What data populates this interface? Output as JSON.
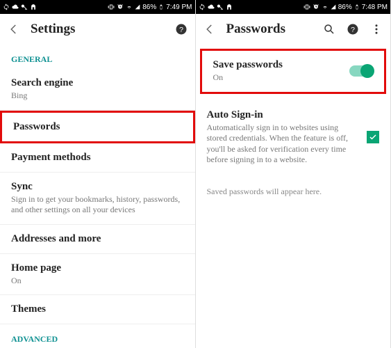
{
  "left": {
    "statusbar": {
      "battery": "86%",
      "time": "7:49 PM"
    },
    "title": "Settings",
    "section_general": "GENERAL",
    "items": {
      "search_engine": {
        "label": "Search engine",
        "value": "Bing"
      },
      "passwords": {
        "label": "Passwords"
      },
      "payment_methods": {
        "label": "Payment methods"
      },
      "sync": {
        "label": "Sync",
        "desc": "Sign in to get your bookmarks, history, passwords, and other settings on all your devices"
      },
      "addresses": {
        "label": "Addresses and more"
      },
      "home_page": {
        "label": "Home page",
        "value": "On"
      },
      "themes": {
        "label": "Themes"
      }
    },
    "section_advanced": "ADVANCED"
  },
  "right": {
    "statusbar": {
      "battery": "86%",
      "time": "7:48 PM"
    },
    "title": "Passwords",
    "save_passwords": {
      "label": "Save passwords",
      "value": "On"
    },
    "auto_signin": {
      "label": "Auto Sign-in",
      "desc": "Automatically sign in to websites using stored credentials. When the feature is off, you'll be asked for verification every time before signing in to a website."
    },
    "empty": "Saved passwords will appear here."
  }
}
